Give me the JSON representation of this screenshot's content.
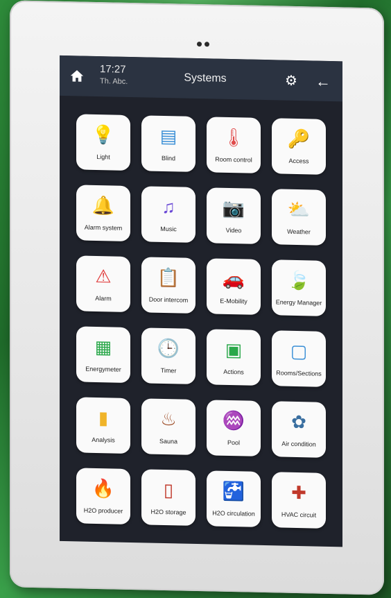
{
  "header": {
    "time": "17:27",
    "date": "Th. Abc.",
    "title": "Systems"
  },
  "colors": {
    "topbar": "#2b3341",
    "screen": "#1f222b",
    "tile": "#fafafa",
    "background": "#2e8b3a"
  },
  "tiles": [
    {
      "label": "Light",
      "icon": "lightbulb-icon",
      "glyph": "💡",
      "color": "#f5b400"
    },
    {
      "label": "Blind",
      "icon": "blind-icon",
      "glyph": "▤",
      "color": "#3a8fd6"
    },
    {
      "label": "Room control",
      "icon": "thermometer-icon",
      "glyph": "🌡",
      "color": "#e04b4b"
    },
    {
      "label": "Access",
      "icon": "key-icon",
      "glyph": "🔑",
      "color": "#f0b429"
    },
    {
      "label": "Alarm system",
      "icon": "alarm-icon",
      "glyph": "🔔",
      "color": "#e03a3a"
    },
    {
      "label": "Music",
      "icon": "music-icon",
      "glyph": "♫",
      "color": "#6b4ad6"
    },
    {
      "label": "Video",
      "icon": "camera-icon",
      "glyph": "📷",
      "color": "#3a8fd6"
    },
    {
      "label": "Weather",
      "icon": "weather-icon",
      "glyph": "⛅",
      "color": "#f0a020"
    },
    {
      "label": "Alarm",
      "icon": "warning-icon",
      "glyph": "⚠",
      "color": "#e03a3a"
    },
    {
      "label": "Door intercom",
      "icon": "intercom-icon",
      "glyph": "📋",
      "color": "#3a8fd6"
    },
    {
      "label": "E-Mobility",
      "icon": "car-icon",
      "glyph": "🚗",
      "color": "#3a8fd6"
    },
    {
      "label": "Energy Manager",
      "icon": "leaf-icon",
      "glyph": "🍃",
      "color": "#2aa84a"
    },
    {
      "label": "Energymeter",
      "icon": "meter-icon",
      "glyph": "▦",
      "color": "#2aa84a"
    },
    {
      "label": "Timer",
      "icon": "clock-icon",
      "glyph": "🕒",
      "color": "#555555"
    },
    {
      "label": "Actions",
      "icon": "actions-icon",
      "glyph": "▣",
      "color": "#2aa84a"
    },
    {
      "label": "Rooms/Sections",
      "icon": "rooms-icon",
      "glyph": "▢",
      "color": "#3a8fd6"
    },
    {
      "label": "Analysis",
      "icon": "bar-chart-icon",
      "glyph": "▮",
      "color": "#f0b429"
    },
    {
      "label": "Sauna",
      "icon": "sauna-icon",
      "glyph": "♨",
      "color": "#a0522d"
    },
    {
      "label": "Pool",
      "icon": "pool-icon",
      "glyph": "♒",
      "color": "#3a8fd6"
    },
    {
      "label": "Air condition",
      "icon": "fan-icon",
      "glyph": "✿",
      "color": "#3a6fa0"
    },
    {
      "label": "H2O producer",
      "icon": "boiler-icon",
      "glyph": "🔥",
      "color": "#f0a020"
    },
    {
      "label": "H2O storage",
      "icon": "tank-icon",
      "glyph": "▯",
      "color": "#c0392b"
    },
    {
      "label": "H2O circulation",
      "icon": "tap-icon",
      "glyph": "🚰",
      "color": "#7f8c9a"
    },
    {
      "label": "HVAC circuit",
      "icon": "pump-icon",
      "glyph": "✚",
      "color": "#c0392b"
    }
  ]
}
